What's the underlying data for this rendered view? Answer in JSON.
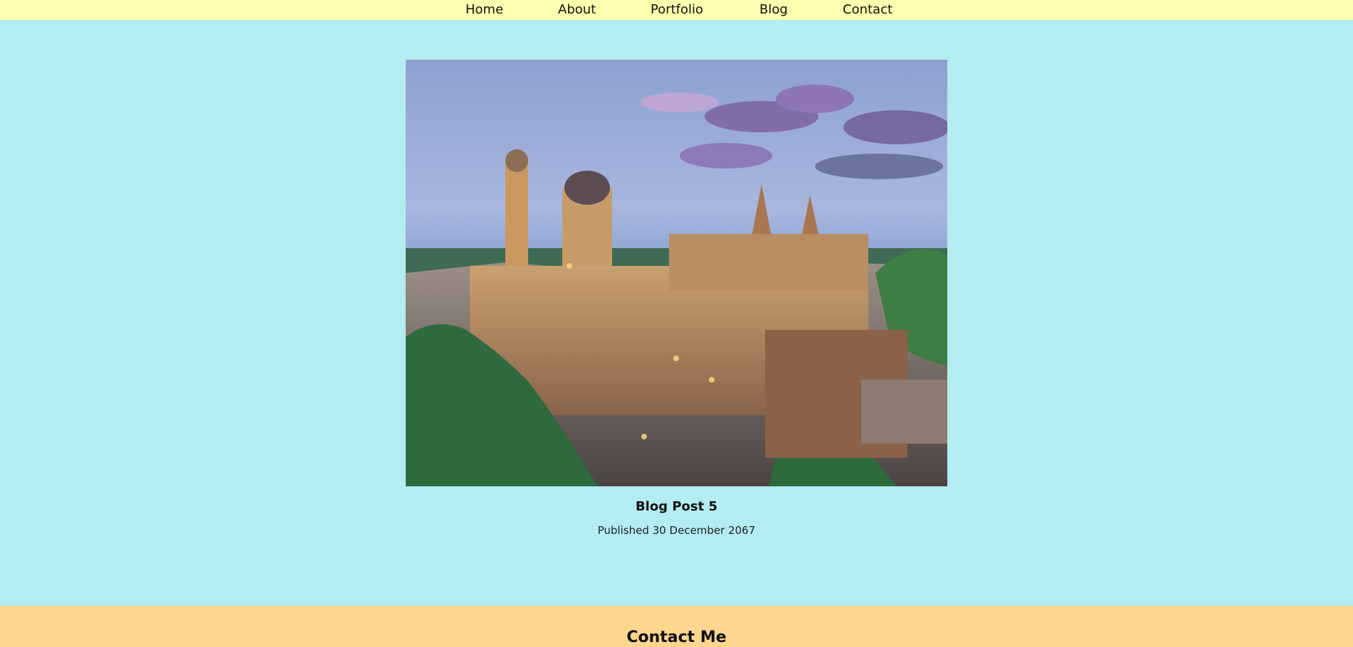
{
  "nav": {
    "home": "Home",
    "about": "About",
    "portfolio": "Portfolio",
    "blog": "Blog",
    "contact": "Contact"
  },
  "post": {
    "title": "Blog Post 5",
    "date": "Published 30 December 2067"
  },
  "footer": {
    "title": "Contact Me"
  },
  "colors": {
    "nav_bg": "#ffffb0",
    "page_bg": "#b3ecf1",
    "footer_bg": "#ffd68d"
  }
}
